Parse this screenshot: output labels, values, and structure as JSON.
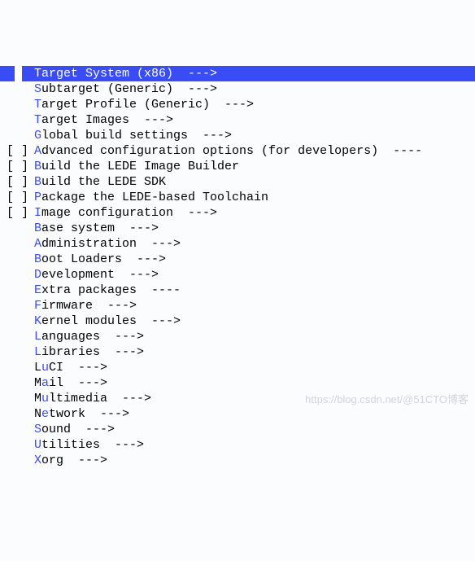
{
  "menu": {
    "items": [
      {
        "prefix": "",
        "hotkey": "T",
        "rest": "arget System (x86)  --->",
        "selected": true
      },
      {
        "prefix": "",
        "hotkey": "S",
        "rest": "ubtarget (Generic)  --->",
        "selected": false
      },
      {
        "prefix": "",
        "hotkey": "T",
        "rest": "arget Profile (Generic)  --->",
        "selected": false
      },
      {
        "prefix": "",
        "hotkey": "T",
        "rest": "arget Images  --->",
        "selected": false
      },
      {
        "prefix": "",
        "hotkey": "G",
        "rest": "lobal build settings  --->",
        "selected": false
      },
      {
        "prefix": "[ ]",
        "hotkey": "A",
        "rest": "dvanced configuration options (for developers)  ----",
        "selected": false
      },
      {
        "prefix": "[ ]",
        "hotkey": "B",
        "rest": "uild the LEDE Image Builder",
        "selected": false
      },
      {
        "prefix": "[ ]",
        "hotkey": "B",
        "rest": "uild the LEDE SDK",
        "selected": false
      },
      {
        "prefix": "[ ]",
        "hotkey": "P",
        "rest": "ackage the LEDE-based Toolchain",
        "selected": false
      },
      {
        "prefix": "[ ]",
        "hotkey": "I",
        "rest": "mage configuration  --->",
        "selected": false
      },
      {
        "prefix": "",
        "hotkey": "B",
        "rest": "ase system  --->",
        "selected": false
      },
      {
        "prefix": "",
        "hotkey": "A",
        "rest": "dministration  --->",
        "selected": false
      },
      {
        "prefix": "",
        "hotkey": "B",
        "rest": "oot Loaders  --->",
        "selected": false
      },
      {
        "prefix": "",
        "hotkey": "D",
        "rest": "evelopment  --->",
        "selected": false
      },
      {
        "prefix": "",
        "hotkey": "E",
        "rest": "xtra packages  ----",
        "selected": false
      },
      {
        "prefix": "",
        "hotkey": "F",
        "rest": "irmware  --->",
        "selected": false
      },
      {
        "prefix": "",
        "hotkey": "K",
        "rest": "ernel modules  --->",
        "selected": false
      },
      {
        "prefix": "",
        "hotkey": "L",
        "rest": "anguages  --->",
        "selected": false
      },
      {
        "prefix": "",
        "hotkey": "L",
        "rest": "ibraries  --->",
        "selected": false
      },
      {
        "prefix": "",
        "pre": "L",
        "hotkey": "u",
        "rest": "CI  --->",
        "selected": false
      },
      {
        "prefix": "",
        "pre": "M",
        "hotkey": "a",
        "rest": "il  --->",
        "selected": false
      },
      {
        "prefix": "",
        "pre": "M",
        "hotkey": "u",
        "rest": "ltimedia  --->",
        "selected": false
      },
      {
        "prefix": "",
        "pre": "N",
        "hotkey": "e",
        "rest": "twork  --->",
        "selected": false
      },
      {
        "prefix": "",
        "hotkey": "S",
        "rest": "ound  --->",
        "selected": false
      },
      {
        "prefix": "",
        "hotkey": "U",
        "rest": "tilities  --->",
        "selected": false
      },
      {
        "prefix": "",
        "hotkey": "X",
        "rest": "org  --->",
        "selected": false
      }
    ]
  },
  "watermark": "https://blog.csdn.net/@51CTO博客"
}
